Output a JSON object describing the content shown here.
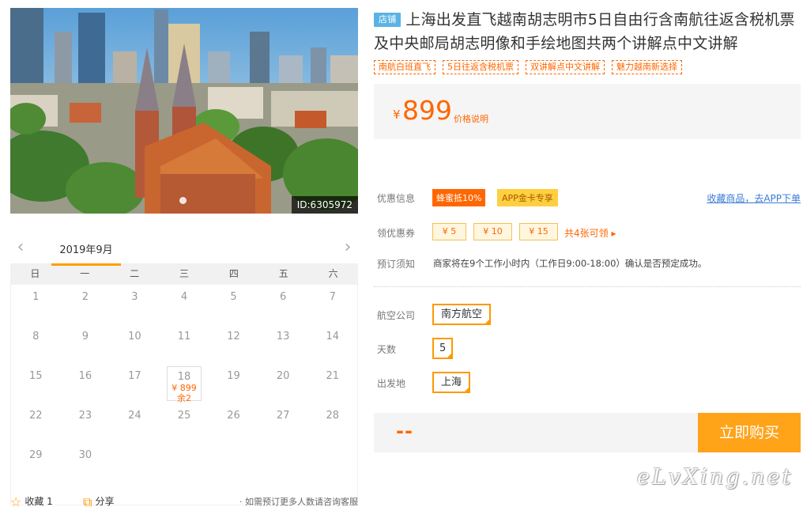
{
  "hero": {
    "id_label": "ID:6305972"
  },
  "calendar": {
    "month": "2019年9月",
    "prev": "‹",
    "next": "›",
    "weekdays": [
      "日",
      "一",
      "二",
      "三",
      "四",
      "五",
      "六"
    ],
    "days": [
      "1",
      "2",
      "3",
      "4",
      "5",
      "6",
      "7",
      "8",
      "9",
      "10",
      "11",
      "12",
      "13",
      "14",
      "15",
      "16",
      "17",
      "18",
      "19",
      "20",
      "21",
      "22",
      "23",
      "24",
      "25",
      "26",
      "27",
      "28",
      "29",
      "30"
    ],
    "selected": {
      "day": "18",
      "price": "¥ 899",
      "stock": "余2"
    }
  },
  "bottom": {
    "fav": "收藏 1",
    "share": "分享",
    "note": "· 如需预订更多人数请咨询客服"
  },
  "product": {
    "store_badge": "店铺",
    "title": "上海出发直飞越南胡志明市5日自由行含南航往返含税机票及中央邮局胡志明像和手绘地图共两个讲解点中文讲解",
    "tags": [
      "南航白班直飞",
      "5日往返含税机票",
      "双讲解点中文讲解",
      "魅力越南新选择"
    ]
  },
  "price": {
    "symbol": "¥",
    "value": "899",
    "note": "价格说明"
  },
  "promo": {
    "label": "优惠信息",
    "badge1": "蜂蜜抵10%",
    "badge2": "APP金卡专享",
    "link": "收藏商品，去APP下单"
  },
  "coupon": {
    "label": "领优惠券",
    "items": [
      "¥ 5",
      "¥ 10",
      "¥ 15"
    ],
    "more": "共4张可领 ▸"
  },
  "notice": {
    "label": "预订须知",
    "text": "商家将在9个工作小时内（工作日9:00-18:00）确认是否预定成功。"
  },
  "options": {
    "airline": {
      "label": "航空公司",
      "value": "南方航空"
    },
    "days": {
      "label": "天数",
      "value": "5"
    },
    "origin": {
      "label": "出发地",
      "value": "上海"
    }
  },
  "buy": {
    "price_placeholder": "--",
    "button": "立即购买"
  },
  "watermark": "eLvXing.net",
  "colors": {
    "accent": "#ff6600",
    "button": "#ffa319",
    "badge_store": "#5ab3e5"
  }
}
